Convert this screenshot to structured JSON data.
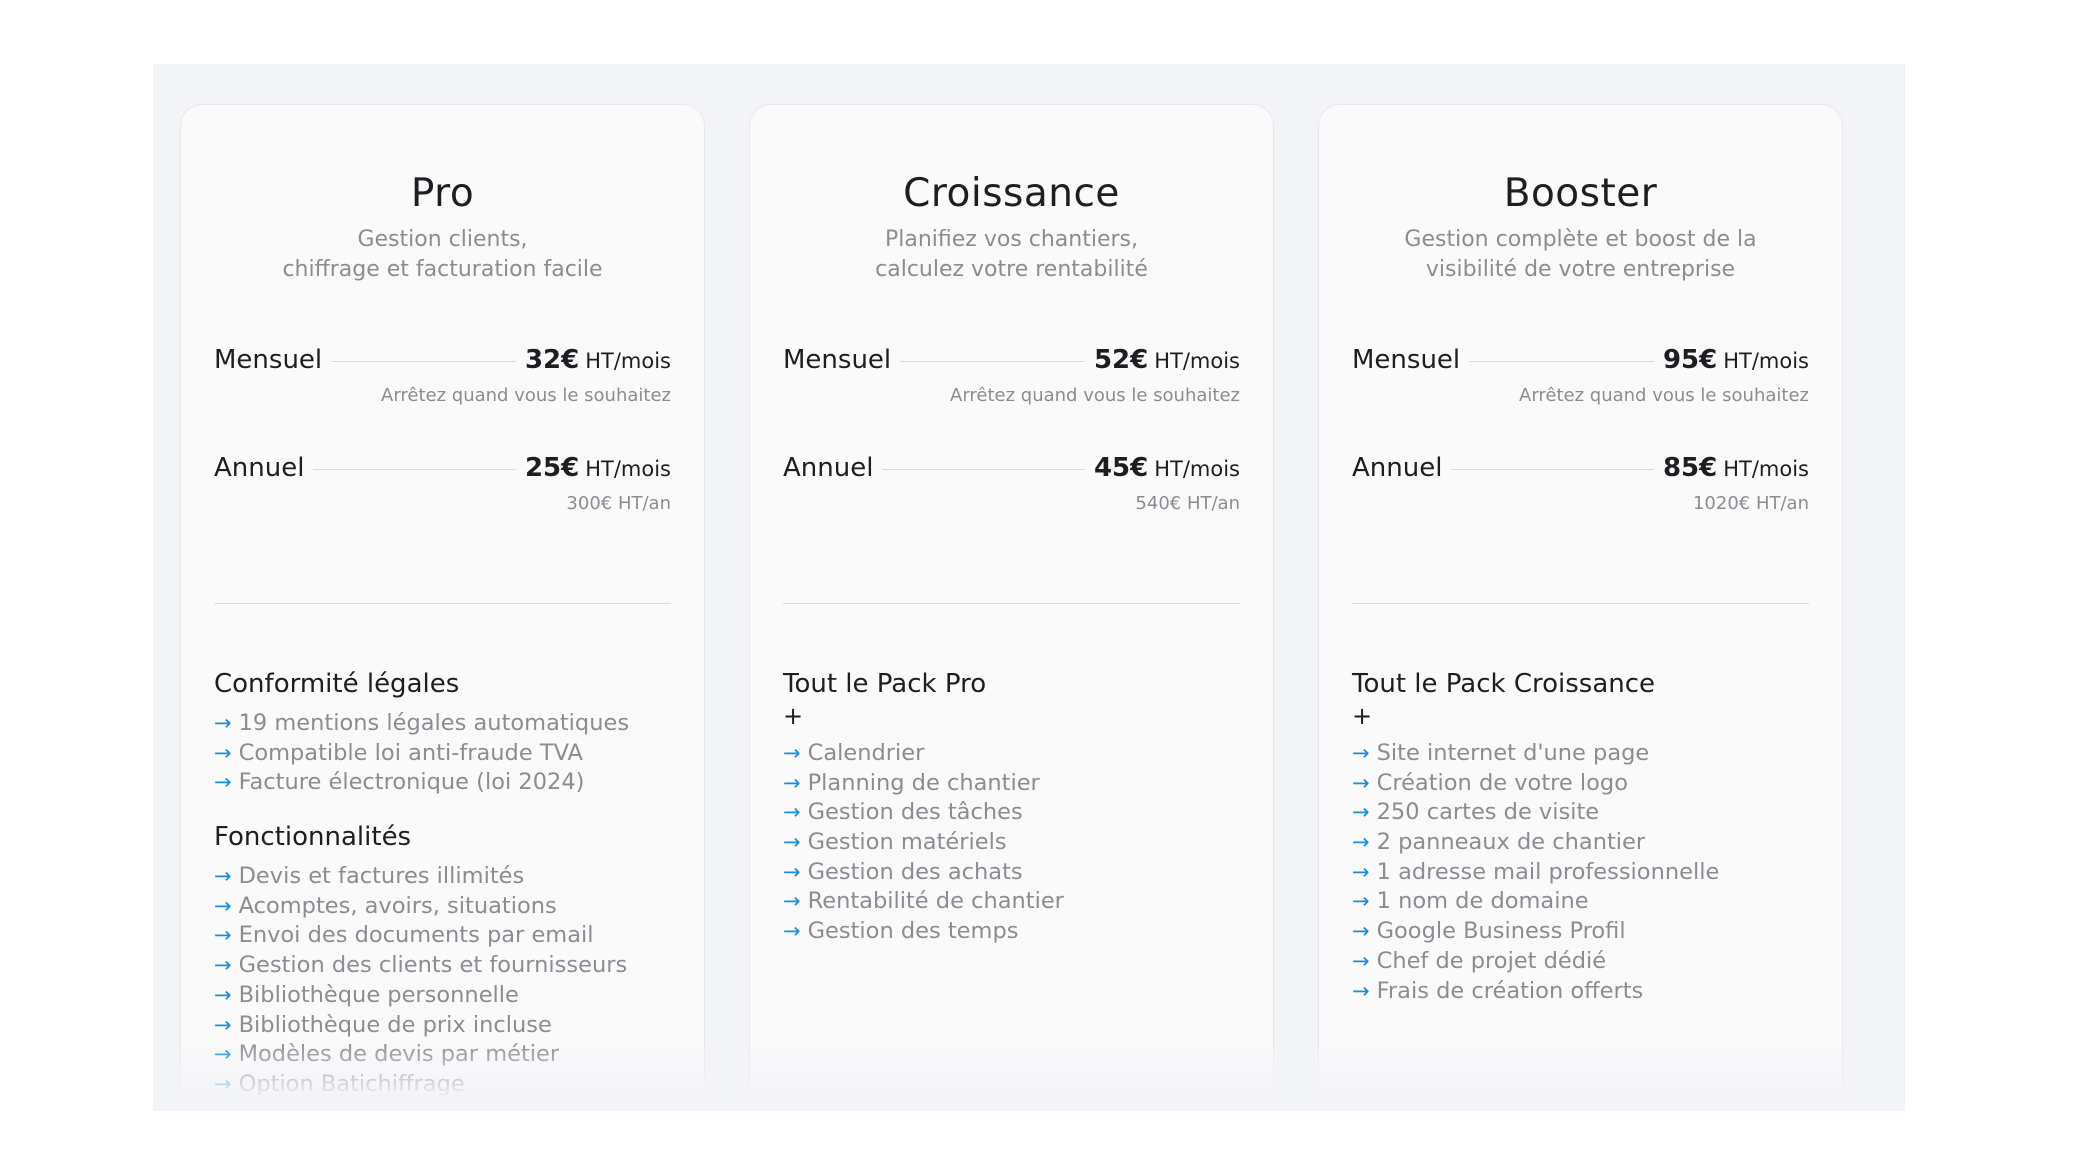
{
  "plans": [
    {
      "title": "Pro",
      "subtitle_lines": [
        "Gestion clients,",
        "chiffrage et facturation facile"
      ],
      "monthly": {
        "label": "Mensuel",
        "price": "32€",
        "unit": "HT/mois",
        "note": "Arrêtez quand vous le souhaitez"
      },
      "annual": {
        "label": "Annuel",
        "price": "25€",
        "unit": "HT/mois",
        "note": "300€ HT/an"
      },
      "sections": [
        {
          "title": "Conformité légales",
          "items": [
            "19 mentions légales automatiques",
            "Compatible loi anti-fraude TVA",
            "Facture électronique (loi 2024)"
          ]
        },
        {
          "title": "Fonctionnalités",
          "items": [
            "Devis et factures illimités",
            "Acomptes, avoirs, situations",
            "Envoi des documents par email",
            "Gestion des clients et fournisseurs",
            "Bibliothèque personnelle",
            "Bibliothèque de prix incluse",
            "Modèles de devis par métier",
            "Option Batichiffrage"
          ]
        }
      ]
    },
    {
      "title": "Croissance",
      "subtitle_lines": [
        "Planifiez vos chantiers,",
        "calculez votre rentabilité"
      ],
      "monthly": {
        "label": "Mensuel",
        "price": "52€",
        "unit": "HT/mois",
        "note": "Arrêtez quand vous le souhaitez"
      },
      "annual": {
        "label": "Annuel",
        "price": "45€",
        "unit": "HT/mois",
        "note": "540€ HT/an"
      },
      "sections": [
        {
          "title": "Tout le Pack Pro",
          "plus": "+",
          "items": [
            "Calendrier",
            "Planning de chantier",
            "Gestion des tâches",
            "Gestion matériels",
            "Gestion des achats",
            "Rentabilité de chantier",
            "Gestion des temps"
          ]
        }
      ]
    },
    {
      "title": "Booster",
      "subtitle_lines": [
        "Gestion complète et boost de la",
        "visibilité de votre entreprise"
      ],
      "monthly": {
        "label": "Mensuel",
        "price": "95€",
        "unit": "HT/mois",
        "note": "Arrêtez quand vous le souhaitez"
      },
      "annual": {
        "label": "Annuel",
        "price": "85€",
        "unit": "HT/mois",
        "note": "1020€ HT/an"
      },
      "sections": [
        {
          "title": "Tout le Pack Croissance",
          "plus": "+",
          "items": [
            "Site internet d'une page",
            "Création de votre logo",
            "250 cartes de visite",
            "2 panneaux de chantier",
            "1 adresse mail professionnelle",
            "1 nom de domaine",
            "Google Business Profil",
            "Chef de projet dédié",
            "Frais de création offerts"
          ]
        }
      ]
    }
  ],
  "arrow_glyph": "→",
  "colors": {
    "accent_arrow": "#1a8ed6",
    "panel_bg": "#f3f4f7",
    "card_bg": "#fafafb",
    "muted_text": "#8b8d93",
    "heading_text": "#1d1e22"
  }
}
